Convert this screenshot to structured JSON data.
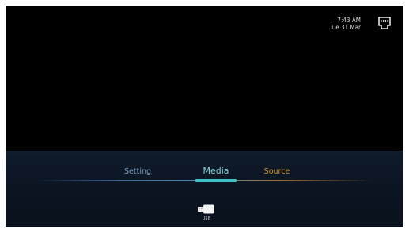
{
  "status": {
    "time": "7:43 AM",
    "date": "Tue 31 Mar",
    "network_icon": "ethernet-icon"
  },
  "menu": {
    "tabs": [
      {
        "label": "Setting"
      },
      {
        "label": "Media",
        "selected": true
      },
      {
        "label": "Source"
      }
    ],
    "items": [
      {
        "label": "USB",
        "icon": "usb-drive-icon"
      }
    ]
  },
  "colors": {
    "selected_tab": "#7fd5da",
    "underline": "#3fc1c6",
    "setting_tab": "#7ea2c6",
    "source_tab": "#d8942c"
  }
}
